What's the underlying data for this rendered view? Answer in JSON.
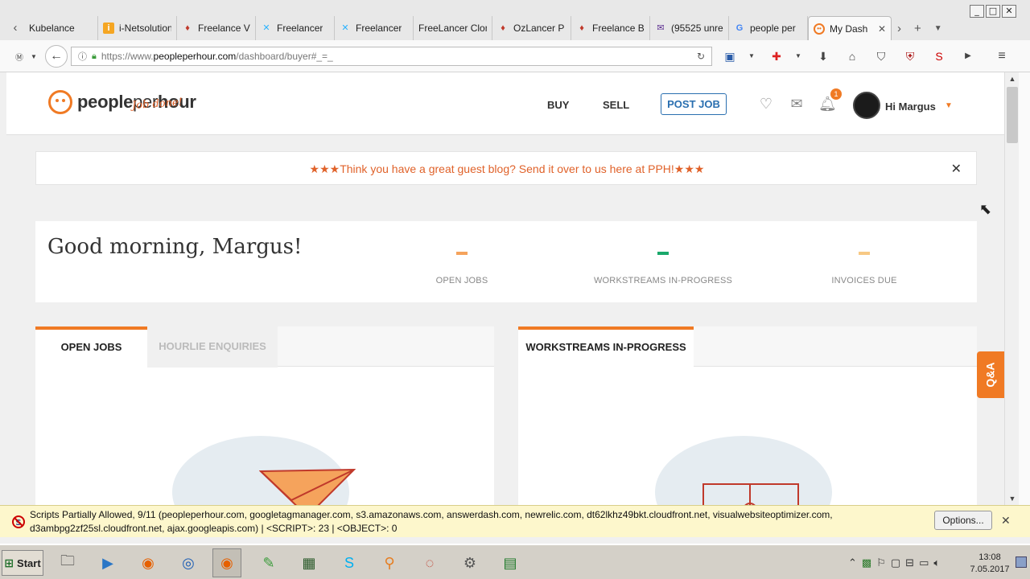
{
  "browser": {
    "tabs": [
      {
        "label": "Kubelance",
        "icon": "kubelance-icon",
        "color": "#5b6bb5"
      },
      {
        "label": "i-Netsolution",
        "icon": "inetsolution-icon",
        "color": "#f5a623"
      },
      {
        "label": "Freelance V",
        "icon": "freelance-icon",
        "color": "#c0392b"
      },
      {
        "label": "Freelancer",
        "icon": "freelancer-icon",
        "color": "#29b2fe"
      },
      {
        "label": "Freelancer",
        "icon": "freelancer-icon",
        "color": "#29b2fe"
      },
      {
        "label": "FreeLancer Clone",
        "icon": "",
        "color": ""
      },
      {
        "label": "OzLancer P",
        "icon": "ozlancer-icon",
        "color": "#c0392b"
      },
      {
        "label": "Freelance B",
        "icon": "freelance-icon",
        "color": "#c0392b"
      },
      {
        "label": "(95525 unre",
        "icon": "mail-icon",
        "color": "#5c2d91"
      },
      {
        "label": "people per",
        "icon": "google-icon",
        "color": "#4285f4"
      },
      {
        "label": "My Dash",
        "icon": "pph-icon",
        "color": "#f07a24",
        "active": true
      }
    ],
    "url_scheme": "https://www.",
    "url_host": "peopleperhour.com",
    "url_path": "/dashboard/buyer#_=_",
    "window_controls": [
      "_",
      "□",
      "✕"
    ]
  },
  "site": {
    "logo_text_bold": "people",
    "logo_text_light": "per",
    "logo_text_bold2": "hour",
    "logo_tagline": "Job done!",
    "nav": {
      "buy": "BUY",
      "sell": "SELL",
      "post_job": "POST JOB"
    },
    "notifications_count": "1",
    "user_greeting": "Hi Margus",
    "banner_text": "★★★Think you have a great guest blog? Send it over to us here at PPH!★★★",
    "banner_close": "✕",
    "greeting": "Good morning, Margus!",
    "stats": [
      {
        "label": "OPEN JOBS",
        "color": "#f5a35c"
      },
      {
        "label": "WORKSTREAMS IN-PROGRESS",
        "color": "#1aa86b"
      },
      {
        "label": "INVOICES DUE",
        "color": "#f7c984"
      }
    ],
    "left_panel": {
      "tab_active": "OPEN JOBS",
      "tab_inactive": "HOURLIE ENQUIRIES"
    },
    "right_panel": {
      "tab_active": "WORKSTREAMS IN-PROGRESS"
    },
    "qa_label": "Q&A",
    "accent": "#f07a24"
  },
  "noscript": {
    "line1": "Scripts Partially Allowed, 9/11 (peopleperhour.com, googletagmanager.com, s3.amazonaws.com, answerdash.com, newrelic.com, dt62lkhz49bkt.cloudfront.net, visualwebsiteoptimizer.com,",
    "line2": "d3ambpg2zf25sl.cloudfront.net, ajax.googleapis.com) | <SCRIPT>: 23 | <OBJECT>: 0",
    "options": "Options...",
    "close": "✕"
  },
  "taskbar": {
    "start": "Start",
    "time": "13:08",
    "date": "7.05.2017"
  }
}
